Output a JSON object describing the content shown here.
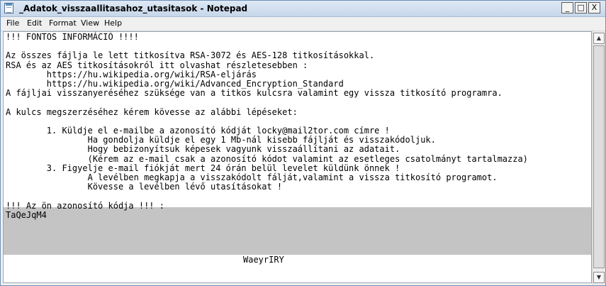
{
  "window": {
    "title": "_Adatok_visszaallitasahoz_utasitasok - Notepad",
    "controls": {
      "minimize": "_",
      "maximize": "□",
      "close": "X"
    }
  },
  "menu": [
    "File",
    "Edit",
    "Format",
    "View",
    "Help"
  ],
  "editor": {
    "lines": [
      "!!! FONTOS INFORMÁCIÓ !!!!",
      "",
      "Az összes fájlja le lett titkosítva RSA-3072 és AES-128 titkosításokkal.",
      "RSA és az AES titkosításokról itt olvashat részletesebben :",
      "        https://hu.wikipedia.org/wiki/RSA-eljárás",
      "        https://hu.wikipedia.org/wiki/Advanced_Encryption_Standard",
      "A fájljai visszanyeréséhez szüksége van a titkos kulcsra valamint egy vissza titkosító programra.",
      "",
      "A kulcs megszerzéséhez kérem kövesse az alábbi lépéseket:",
      "",
      "        1. Küldje el e-mailbe a azonosító kódját locky@mail2tor.com címre !",
      "                Ha gondolja küldje el egy 1 Mb-nál kisebb fájlját és visszakódoljuk.",
      "                Hogy bebizonyítsuk képesek vagyunk visszaállítani az adatait.",
      "                (Kérem az e-mail csak a azonosító kódot valamint az esetleges csatolmányt tartalmazza)",
      "        3. Figyelje e-mail fiókját mert 24 órán belül levelet küldünk önnek !",
      "                A levélben megkapja a visszakódolt fálját,valamint a vissza titkosító programot.",
      "                Kövesse a levélben lévő utasításokat !",
      "",
      "!!! Az ön azonosító kódja !!! :",
      "TaQeJqM4"
    ],
    "selected_code_end": "WaeyrIRY"
  },
  "scrollbar": {
    "up_arrow": "▲",
    "down_arrow": "▼"
  },
  "colors": {
    "selection": "#c4c4c4",
    "title_gradient_top": "#dfe9f5",
    "title_gradient_bottom": "#c6d6ea"
  }
}
